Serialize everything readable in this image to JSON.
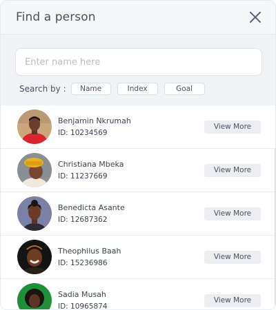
{
  "dialog": {
    "title": "Find a person"
  },
  "search": {
    "placeholder": "Enter name here",
    "search_by_label": "Search by :",
    "filters": [
      "Name",
      "Index",
      "Goal"
    ]
  },
  "people": [
    {
      "name": "Benjamin Nkrumah",
      "id": "ID: 10234569",
      "action": "View More"
    },
    {
      "name": "Christiana Mbeka",
      "id": "ID: 11237669",
      "action": "View More"
    },
    {
      "name": "Benedicta Asante",
      "id": "ID: 12687362",
      "action": "View More"
    },
    {
      "name": "Theophilus Baah",
      "id": "ID: 15236986",
      "action": "View More"
    },
    {
      "name": "Sadia Musah",
      "id": "ID: 10965874",
      "action": "View More"
    }
  ],
  "colors": {
    "header_bg": "#f6f7f9",
    "search_bg": "#f0f2f5",
    "button_bg": "#eceef2",
    "text": "#3d4352"
  }
}
